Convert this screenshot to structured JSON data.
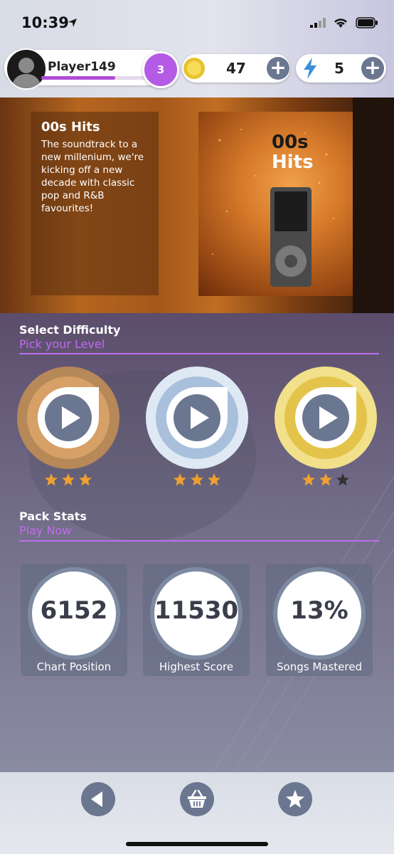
{
  "status_bar": {
    "time": "10:39"
  },
  "player": {
    "name": "Player149",
    "level": "3",
    "xp_progress": 0.7
  },
  "resources": {
    "coins": "47",
    "energy": "5"
  },
  "pack": {
    "title": "00s Hits",
    "description": "The soundtrack to a new millenium, we're kicking off a new decade with classic pop and R&B favourites!",
    "art_title_line1": "00s",
    "art_title_line2": "Hits"
  },
  "difficulty": {
    "title": "Select Difficulty",
    "subtitle": "Pick your Level",
    "levels": [
      {
        "name": "bronze",
        "stars": 3,
        "color": "#c08d5a"
      },
      {
        "name": "silver",
        "stars": 3,
        "color": "#b9cde3"
      },
      {
        "name": "gold",
        "stars": 2,
        "color": "#e9cd62"
      }
    ]
  },
  "stats": {
    "title": "Pack Stats",
    "subtitle": "Play Now",
    "items": [
      {
        "value": "6152",
        "label": "Chart Position"
      },
      {
        "value": "11530",
        "label": "Highest Score"
      },
      {
        "value": "13%",
        "label": "Songs Mastered"
      }
    ]
  },
  "colors": {
    "accent": "#c06cef",
    "button": "#6b7790",
    "star": "#f0a030",
    "star_empty": "#333333"
  }
}
